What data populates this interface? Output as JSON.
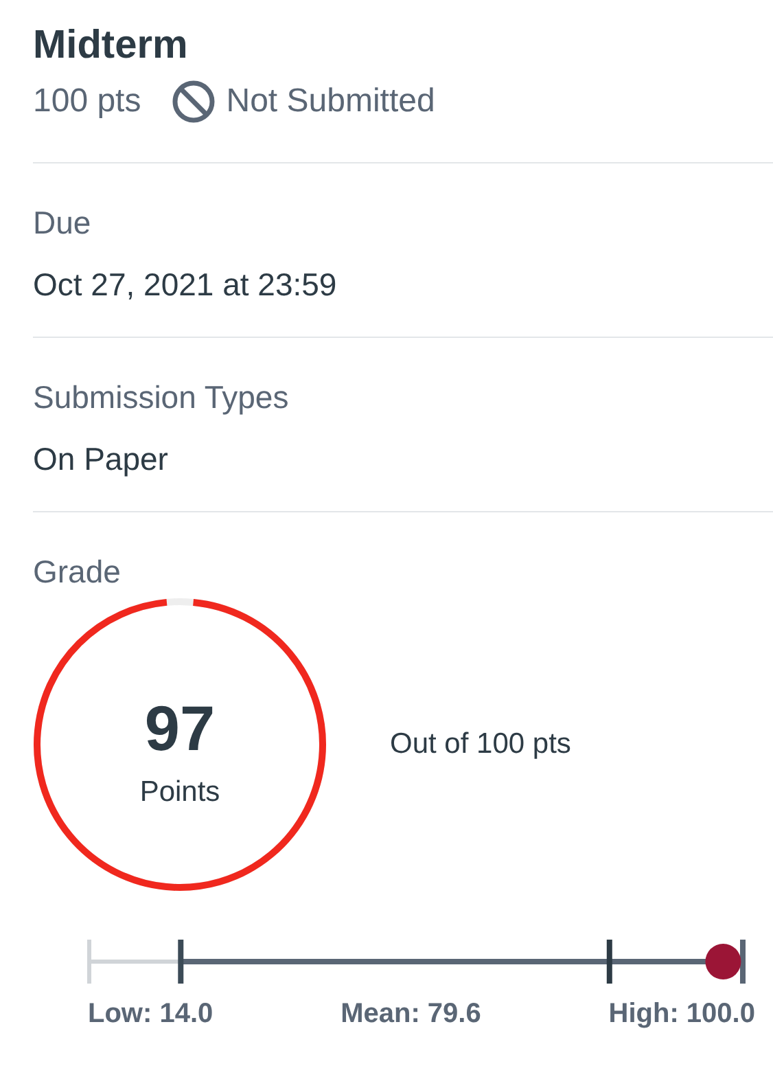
{
  "assignment": {
    "title": "Midterm",
    "points": "100 pts",
    "status": {
      "kind": "not_submitted",
      "label": "Not Submitted"
    }
  },
  "sections": [
    {
      "label": "Due",
      "value": "Oct 27, 2021 at 23:59"
    },
    {
      "label": "Submission Types",
      "value": "On Paper"
    }
  ],
  "grade": {
    "label": "Grade",
    "score": "97",
    "score_unit": "Points",
    "level": 0.97,
    "out_of": "Out of 100 pts",
    "distribution": {
      "score": {
        "level": 0.97
      },
      "markers": [
        {
          "kind": "low",
          "level": 0.14,
          "label": "Low: 14.0"
        },
        {
          "kind": "mean",
          "level": 0.796,
          "label": "Mean: 79.6"
        },
        {
          "kind": "high",
          "level": 1.0,
          "label": "High: 100.0"
        }
      ]
    }
  }
}
